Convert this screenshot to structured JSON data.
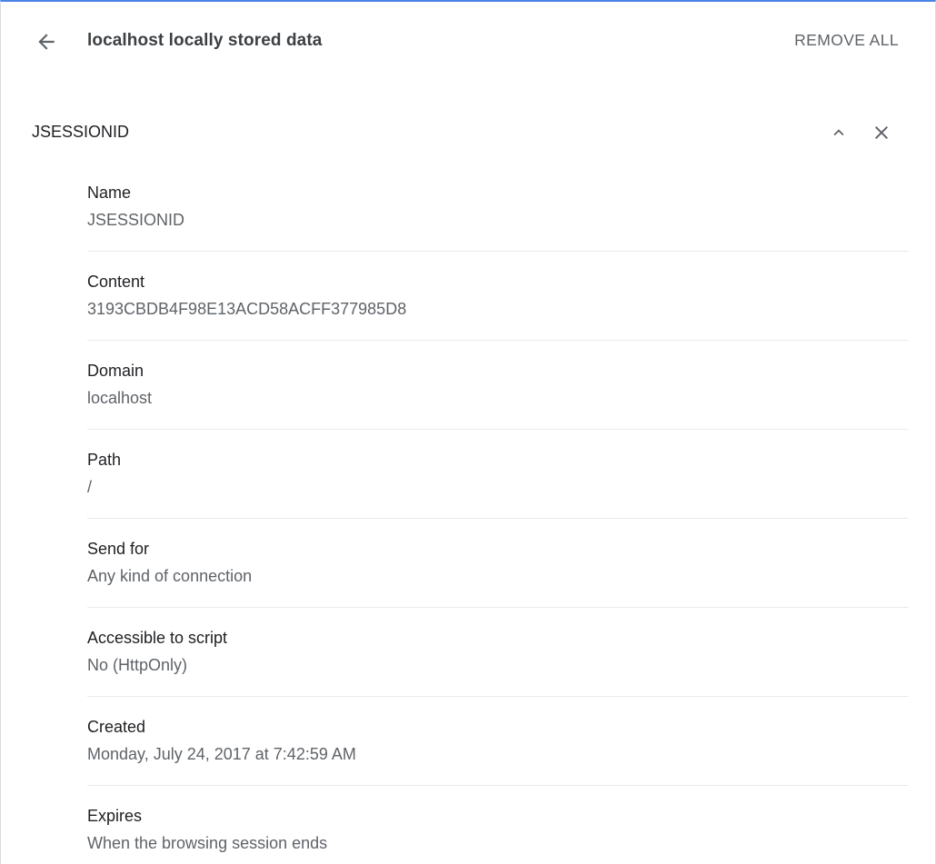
{
  "header": {
    "back_icon": "arrow-back-icon",
    "title": "localhost locally stored data",
    "remove_all_label": "REMOVE ALL"
  },
  "cookie": {
    "name": "JSESSIONID",
    "collapse_icon": "chevron-up-icon",
    "remove_icon": "close-icon",
    "fields": [
      {
        "label": "Name",
        "value": "JSESSIONID"
      },
      {
        "label": "Content",
        "value": "3193CBDB4F98E13ACD58ACFF377985D8"
      },
      {
        "label": "Domain",
        "value": "localhost"
      },
      {
        "label": "Path",
        "value": "/"
      },
      {
        "label": "Send for",
        "value": "Any kind of connection"
      },
      {
        "label": "Accessible to script",
        "value": "No (HttpOnly)"
      },
      {
        "label": "Created",
        "value": "Monday, July 24, 2017 at 7:42:59 AM"
      },
      {
        "label": "Expires",
        "value": "When the browsing session ends"
      }
    ]
  },
  "colors": {
    "accent_border": "#4a84e8",
    "text_primary": "#202124",
    "text_secondary": "#5f6368",
    "divider": "#e8eaed"
  }
}
